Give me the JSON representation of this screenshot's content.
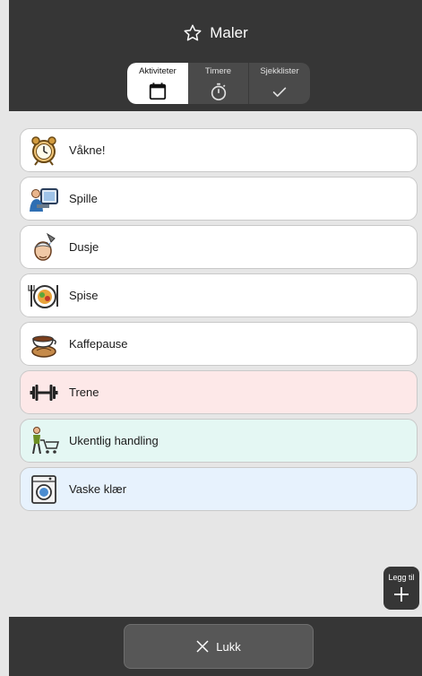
{
  "header": {
    "title": "Maler",
    "title_icon": "star-outline-icon"
  },
  "tabs": [
    {
      "label": "Aktiviteter",
      "icon": "calendar-icon",
      "selected": true
    },
    {
      "label": "Timere",
      "icon": "stopwatch-icon",
      "selected": false
    },
    {
      "label": "Sjekklister",
      "icon": "checkmark-icon",
      "selected": false
    }
  ],
  "templates": [
    {
      "label": "Våkne!",
      "icon": "alarm-clock-icon",
      "color": "#ffffff"
    },
    {
      "label": "Spille",
      "icon": "computer-player-icon",
      "color": "#ffffff"
    },
    {
      "label": "Dusje",
      "icon": "shower-icon",
      "color": "#ffffff"
    },
    {
      "label": "Spise",
      "icon": "plate-cutlery-icon",
      "color": "#ffffff"
    },
    {
      "label": "Kaffepause",
      "icon": "coffee-cup-icon",
      "color": "#ffffff"
    },
    {
      "label": "Trene",
      "icon": "dumbbell-icon",
      "color": "#fde8e8"
    },
    {
      "label": "Ukentlig handling",
      "icon": "shopping-cart-icon",
      "color": "#e4f7f3"
    },
    {
      "label": "Vaske klær",
      "icon": "washing-machine-icon",
      "color": "#e7f2fd"
    }
  ],
  "add_button": {
    "label": "Legg til",
    "icon": "plus-icon"
  },
  "footer": {
    "close_label": "Lukk",
    "close_icon": "close-icon"
  },
  "colors": {
    "header_bg": "#363636",
    "content_bg": "#e6e6e6",
    "item_border": "#c9c9c9"
  }
}
